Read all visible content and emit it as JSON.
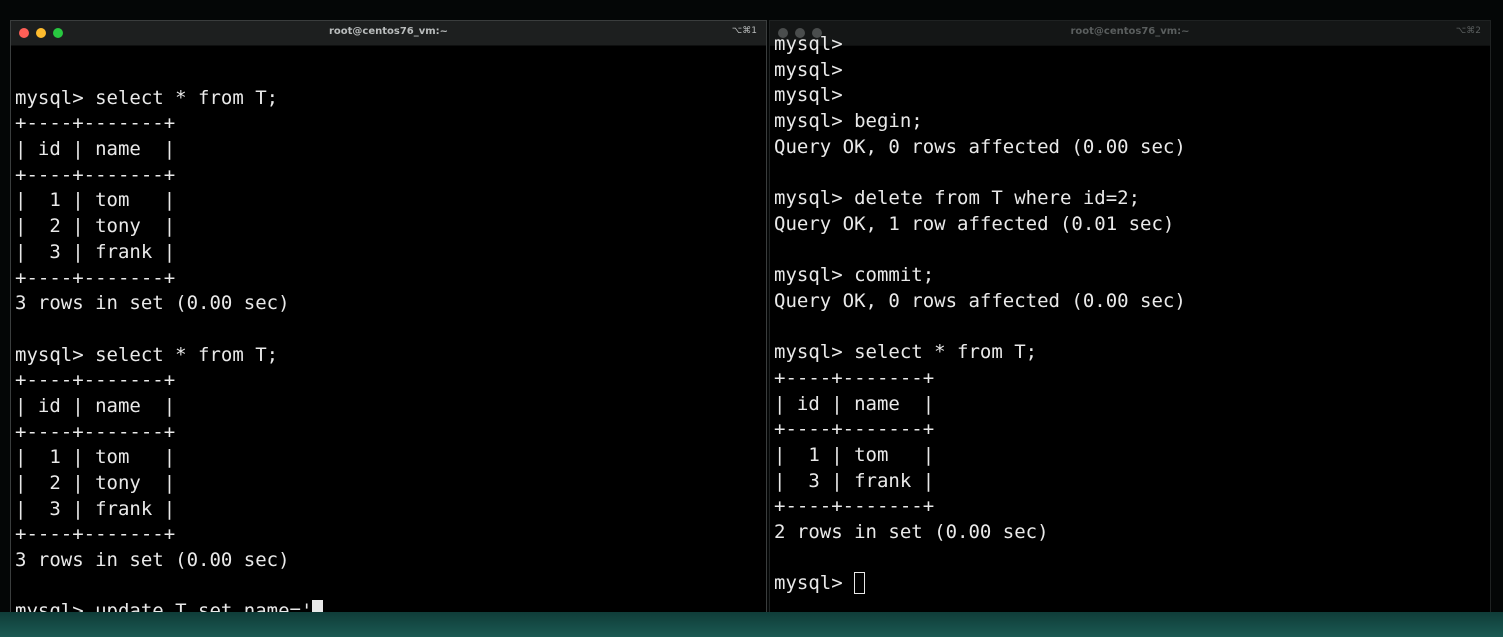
{
  "colors": {
    "light_red": "#fe5f57",
    "light_yellow": "#febc2e",
    "light_green": "#28c840",
    "light_inactive": "#4a4d4d",
    "title_active": "#b9bcbc",
    "title_inactive": "#5a5e5e"
  },
  "terminals": {
    "left": {
      "title": "root@centos76_vm:~",
      "shortcut": "⌥⌘1",
      "lines": [
        "",
        "mysql> select * from T;",
        "+----+-------+",
        "| id | name  |",
        "+----+-------+",
        "|  1 | tom   |",
        "|  2 | tony  |",
        "|  3 | frank |",
        "+----+-------+",
        "3 rows in set (0.00 sec)",
        "",
        "mysql> select * from T;",
        "+----+-------+",
        "| id | name  |",
        "+----+-------+",
        "|  1 | tom   |",
        "|  2 | tony  |",
        "|  3 | frank |",
        "+----+-------+",
        "3 rows in set (0.00 sec)",
        ""
      ],
      "prompt_line": "mysql> update T set name='"
    },
    "right": {
      "title": "root@centos76_vm:~",
      "shortcut": "⌥⌘2",
      "lines": [
        "mysql>",
        "mysql>",
        "mysql>",
        "mysql> begin;",
        "Query OK, 0 rows affected (0.00 sec)",
        "",
        "mysql> delete from T where id=2;",
        "Query OK, 1 row affected (0.01 sec)",
        "",
        "mysql> commit;",
        "Query OK, 0 rows affected (0.00 sec)",
        "",
        "mysql> select * from T;",
        "+----+-------+",
        "| id | name  |",
        "+----+-------+",
        "|  1 | tom   |",
        "|  3 | frank |",
        "+----+-------+",
        "2 rows in set (0.00 sec)",
        ""
      ],
      "prompt_line": "mysql> "
    }
  }
}
